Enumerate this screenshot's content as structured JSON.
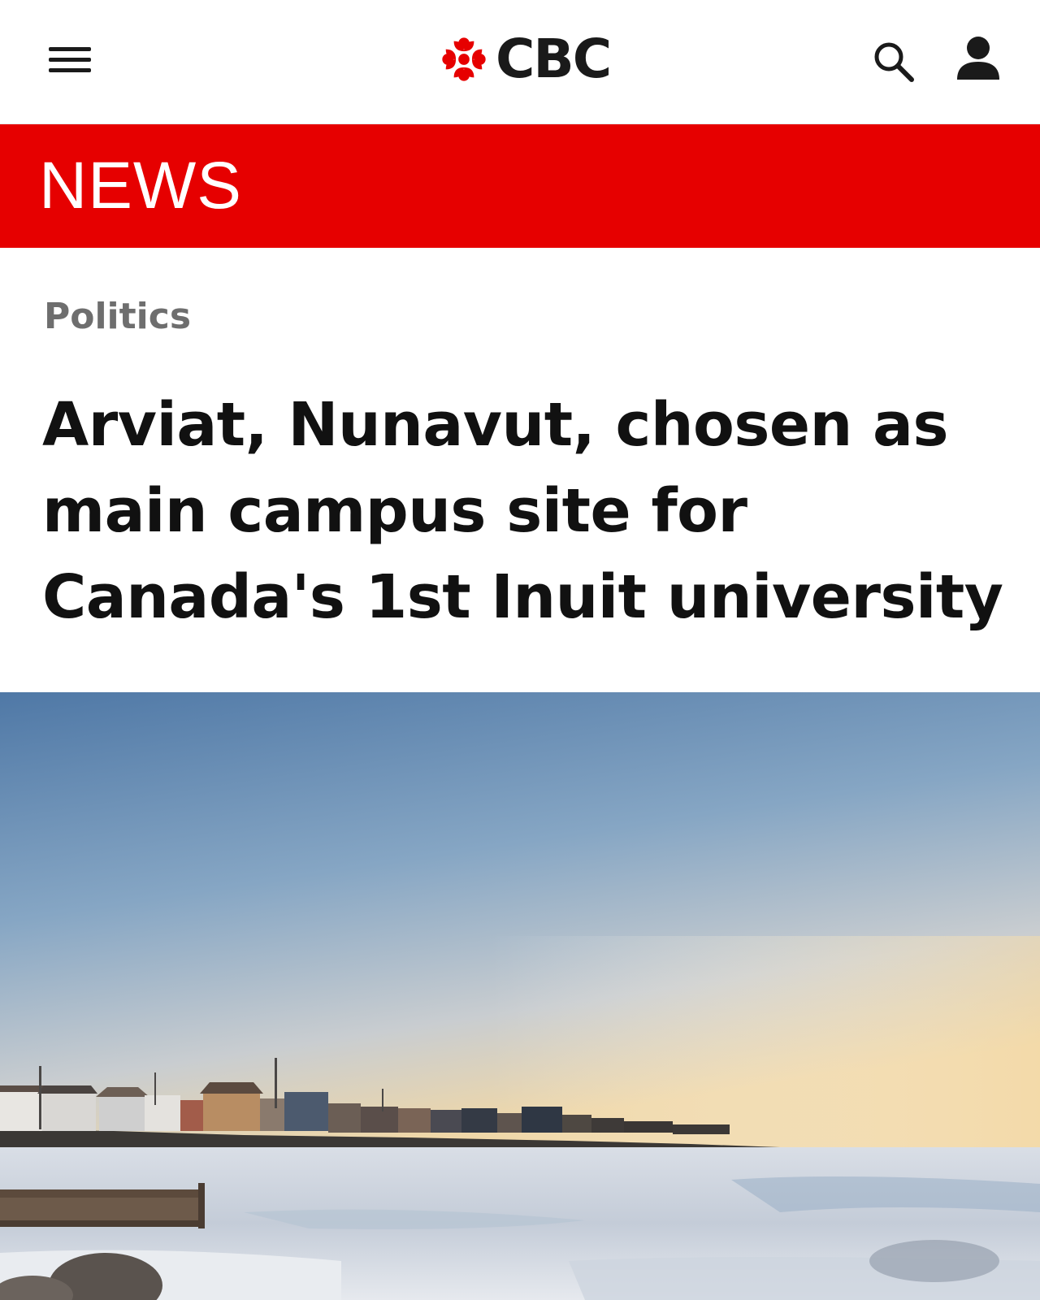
{
  "header": {
    "brand": "CBC",
    "menu_icon": "hamburger-menu-icon",
    "logo_icon": "cbc-gem-icon",
    "search_icon": "search-icon",
    "account_icon": "account-icon",
    "logo_color": "#e60000"
  },
  "banner": {
    "label": "NEWS",
    "color": "#e60000"
  },
  "article": {
    "section": "Politics",
    "headline": "Arviat, Nunavut, chosen as main campus site for Canada's 1st Inuit university"
  },
  "hero_image": {
    "description_icon": "photo-arctic-shoreline"
  }
}
